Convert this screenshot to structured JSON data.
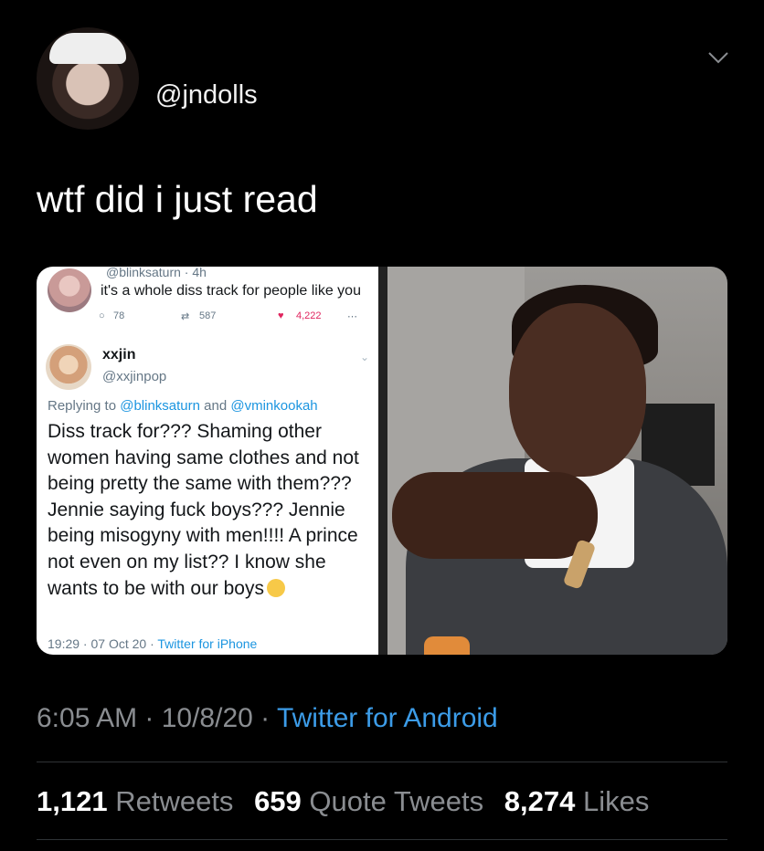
{
  "tweet": {
    "handle": "@jndolls",
    "text": "wtf did i just read",
    "timestamp": "6:05 AM · 10/8/20 · ",
    "source": "Twitter for Android",
    "stats": {
      "retweets_count": "1,121",
      "retweets_label": "Retweets",
      "quotes_count": "659",
      "quotes_label": "Quote Tweets",
      "likes_count": "8,274",
      "likes_label": "Likes"
    }
  },
  "embedded_screenshot": {
    "parent": {
      "handle_time": "@blinksaturn · 4h",
      "text": "it's a whole diss track for people like you",
      "replies": "78",
      "retweets": "587",
      "likes": "4,222"
    },
    "reply": {
      "name": "xxjin",
      "handle": "@xxjinpop",
      "replying_prefix": "Replying to ",
      "replying_user1": "@blinksaturn",
      "replying_and": " and ",
      "replying_user2": "@vminkookah",
      "body": "Diss track for??? Shaming other women having same clothes and not being pretty the same with them??? Jennie saying fuck boys??? Jennie being misogyny with men!!!! A prince not even on my list?? I know she wants  to be with our boys",
      "time_date": "19:29 · 07 Oct 20 · ",
      "client": "Twitter for iPhone"
    }
  },
  "colors": {
    "background": "#000000",
    "link": "#3c9ce8",
    "muted": "#8a8d91",
    "like": "#e0245e"
  },
  "icons": [
    "chevron-down-icon",
    "reply-icon",
    "retweet-icon",
    "heart-icon",
    "share-icon",
    "relieved-face-emoji"
  ]
}
